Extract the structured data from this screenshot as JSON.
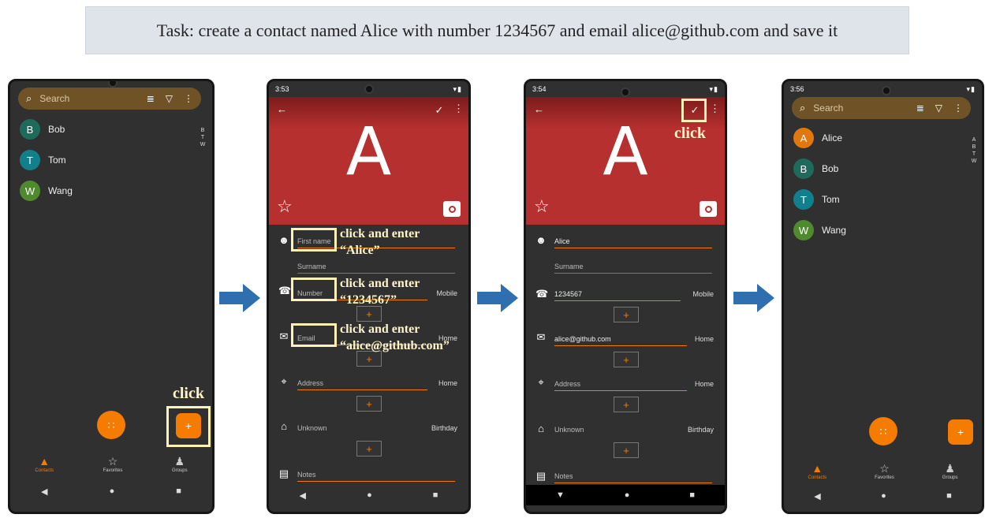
{
  "task": "Task: create a contact named Alice with number 1234567 and email alice@github.com and save it",
  "colors": {
    "accent": "#f57c00",
    "hero": "#b5302f",
    "background": "#303030",
    "highlight": "#fff1b8",
    "arrow": "#2f6fb0"
  },
  "screen1": {
    "search_placeholder": "Search",
    "contacts": [
      {
        "initial": "B",
        "name": "Bob",
        "color": "#1e6b5c"
      },
      {
        "initial": "T",
        "name": "Tom",
        "color": "#11808c"
      },
      {
        "initial": "W",
        "name": "Wang",
        "color": "#4f8a2f"
      }
    ],
    "alpha_index": [
      "B",
      "T",
      "W"
    ],
    "hint_click": "click",
    "nav": {
      "contacts": "Contacts",
      "favorites": "Favorites",
      "groups": "Groups"
    }
  },
  "screen2": {
    "time": "3:53",
    "letter": "A",
    "first_name_placeholder": "First name",
    "surname_placeholder": "Surname",
    "number_placeholder": "Number",
    "number_type": "Mobile",
    "email_placeholder": "Email",
    "email_type": "Home",
    "address_placeholder": "Address",
    "address_type": "Home",
    "birthday_placeholder": "Unknown",
    "birthday_type": "Birthday",
    "notes_placeholder": "Notes",
    "hint_name_1": "click and enter",
    "hint_name_2": "“Alice”",
    "hint_number_1": "click and enter",
    "hint_number_2": "“1234567”",
    "hint_email_1": "click and enter",
    "hint_email_2": "“alice@github.com”"
  },
  "screen3": {
    "time": "3:54",
    "letter": "A",
    "first_name_value": "Alice",
    "surname_placeholder": "Surname",
    "number_value": "1234567",
    "number_type": "Mobile",
    "email_value": "alice@github.com",
    "email_type": "Home",
    "address_placeholder": "Address",
    "address_type": "Home",
    "birthday_placeholder": "Unknown",
    "birthday_type": "Birthday",
    "notes_placeholder": "Notes",
    "hint_click": "click"
  },
  "screen4": {
    "time": "3:56",
    "search_placeholder": "Search",
    "contacts": [
      {
        "initial": "A",
        "name": "Alice",
        "color": "#e0780f"
      },
      {
        "initial": "B",
        "name": "Bob",
        "color": "#1e6b5c"
      },
      {
        "initial": "T",
        "name": "Tom",
        "color": "#11808c"
      },
      {
        "initial": "W",
        "name": "Wang",
        "color": "#4f8a2f"
      }
    ],
    "alpha_index": [
      "A",
      "B",
      "T",
      "W"
    ],
    "nav": {
      "contacts": "Contacts",
      "favorites": "Favorites",
      "groups": "Groups"
    }
  },
  "icons": {
    "search": "search-icon",
    "sort": "sort-icon",
    "filter": "filter-icon",
    "more": "more-vert-icon",
    "dialpad": "dialpad-icon",
    "add": "plus-icon",
    "back": "arrow-back-icon",
    "save": "check-icon",
    "star": "star-outline-icon",
    "camera": "camera-icon",
    "person": "person-icon",
    "phone": "phone-icon",
    "email": "email-icon",
    "location": "location-pin-icon",
    "cake": "cake-icon",
    "notes": "notes-icon"
  }
}
